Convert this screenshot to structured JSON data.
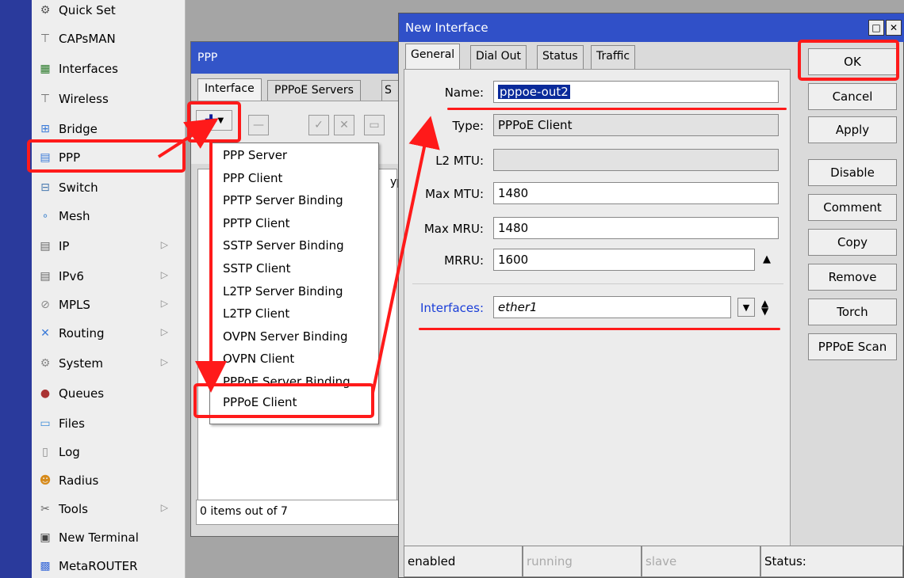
{
  "menu": {
    "items": [
      {
        "label": "Quick Set",
        "icon": "quick-set-icon",
        "submenu": false
      },
      {
        "label": "CAPsMAN",
        "icon": "antenna-icon",
        "submenu": false
      },
      {
        "label": "Interfaces",
        "icon": "interfaces-icon",
        "submenu": false
      },
      {
        "label": "Wireless",
        "icon": "wireless-icon",
        "submenu": false
      },
      {
        "label": "Bridge",
        "icon": "bridge-icon",
        "submenu": false
      },
      {
        "label": "PPP",
        "icon": "ppp-icon",
        "submenu": false
      },
      {
        "label": "Switch",
        "icon": "switch-icon",
        "submenu": false
      },
      {
        "label": "Mesh",
        "icon": "mesh-icon",
        "submenu": false
      },
      {
        "label": "IP",
        "icon": "ip-icon",
        "submenu": true
      },
      {
        "label": "IPv6",
        "icon": "ipv6-icon",
        "submenu": true
      },
      {
        "label": "MPLS",
        "icon": "mpls-icon",
        "submenu": true
      },
      {
        "label": "Routing",
        "icon": "routing-icon",
        "submenu": true
      },
      {
        "label": "System",
        "icon": "system-icon",
        "submenu": true
      },
      {
        "label": "Queues",
        "icon": "queues-icon",
        "submenu": false
      },
      {
        "label": "Files",
        "icon": "files-icon",
        "submenu": false
      },
      {
        "label": "Log",
        "icon": "log-icon",
        "submenu": false
      },
      {
        "label": "Radius",
        "icon": "radius-icon",
        "submenu": false
      },
      {
        "label": "Tools",
        "icon": "tools-icon",
        "submenu": true
      },
      {
        "label": "New Terminal",
        "icon": "terminal-icon",
        "submenu": false
      },
      {
        "label": "MetaROUTER",
        "icon": "metarouter-icon",
        "submenu": false
      }
    ]
  },
  "ppp_window": {
    "title": "PPP",
    "tabs": [
      "Interface",
      "PPPoE Servers",
      "S"
    ],
    "column_fragment": "ype",
    "status": "0 items out of 7",
    "add_menu": [
      "PPP Server",
      "PPP Client",
      "PPTP Server Binding",
      "PPTP Client",
      "SSTP Server Binding",
      "SSTP Client",
      "L2TP Server Binding",
      "L2TP Client",
      "OVPN Server Binding",
      "OVPN Client",
      "PPPoE Server Binding",
      "PPPoE Client"
    ]
  },
  "dialog": {
    "title": "New Interface",
    "tabs": [
      "General",
      "Dial Out",
      "Status",
      "Traffic"
    ],
    "fields": {
      "name_label": "Name:",
      "name_value": "pppoe-out2",
      "type_label": "Type:",
      "type_value": "PPPoE Client",
      "l2mtu_label": "L2 MTU:",
      "l2mtu_value": "",
      "maxmtu_label": "Max MTU:",
      "maxmtu_value": "1480",
      "maxmru_label": "Max MRU:",
      "maxmru_value": "1480",
      "mrru_label": "MRRU:",
      "mrru_value": "1600",
      "interfaces_label": "Interfaces:",
      "interfaces_value": "ether1"
    },
    "buttons": [
      "OK",
      "Cancel",
      "Apply",
      "Disable",
      "Comment",
      "Copy",
      "Remove",
      "Torch",
      "PPPoE Scan"
    ],
    "status_bar": [
      "enabled",
      "running",
      "slave",
      "Status:"
    ]
  },
  "colors": {
    "titlebar": "#3050c8",
    "annotation": "#ff1a1a",
    "interfaces_label": "#1a3ed8",
    "menu_strip": "#2a3a9c"
  }
}
